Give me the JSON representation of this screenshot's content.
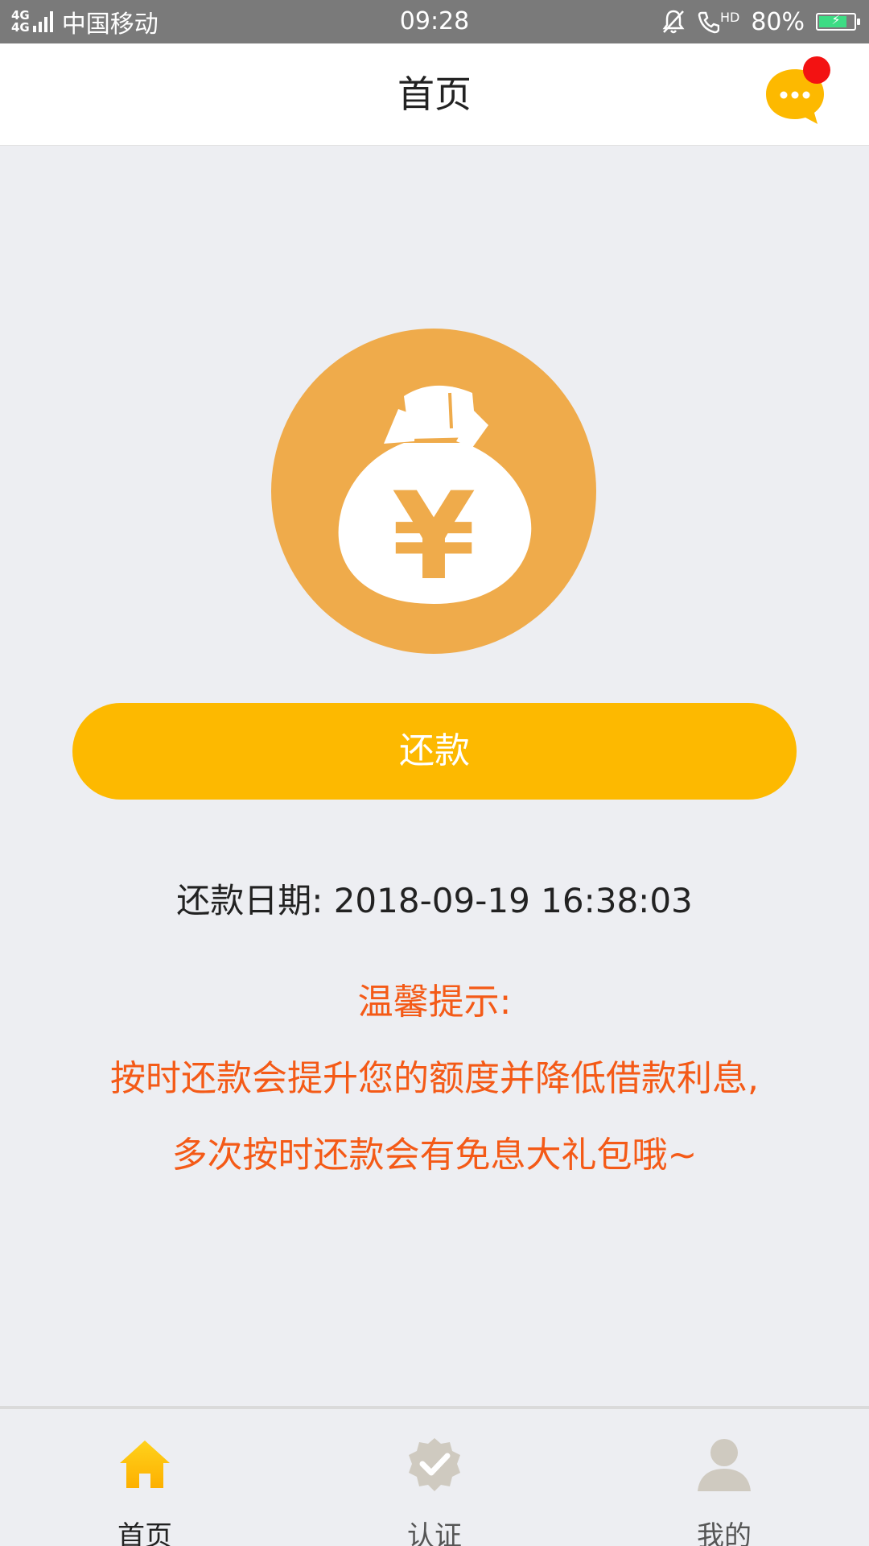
{
  "status_bar": {
    "network_top": "4G",
    "network_bottom": "4G",
    "carrier": "中国移动",
    "time": "09:28",
    "hd_label": "HD",
    "battery_percent": "80%",
    "battery_level": 0.8
  },
  "header": {
    "title": "首页",
    "message_icon": "chat-bubble-icon",
    "has_unread": true
  },
  "main": {
    "hero_icon": "money-bag-icon",
    "hero_symbol": "¥",
    "repay_button_label": "还款",
    "repay_date_label": "还款日期: 2018-09-19 16:38:03",
    "tip_title": "温馨提示:",
    "tip_line1": "按时还款会提升您的额度并降低借款利息,",
    "tip_line2": "多次按时还款会有免息大礼包哦~"
  },
  "tabs": [
    {
      "label": "首页",
      "icon": "home-icon",
      "active": true
    },
    {
      "label": "认证",
      "icon": "verified-badge-icon",
      "active": false
    },
    {
      "label": "我的",
      "icon": "user-icon",
      "active": false
    }
  ],
  "colors": {
    "accent": "#fdb900",
    "hero_circle": "#efab4b",
    "tip_text": "#f45a17",
    "badge": "#f31212",
    "status_bar": "#7a7a7a",
    "inactive_icon": "#cfcac0"
  }
}
